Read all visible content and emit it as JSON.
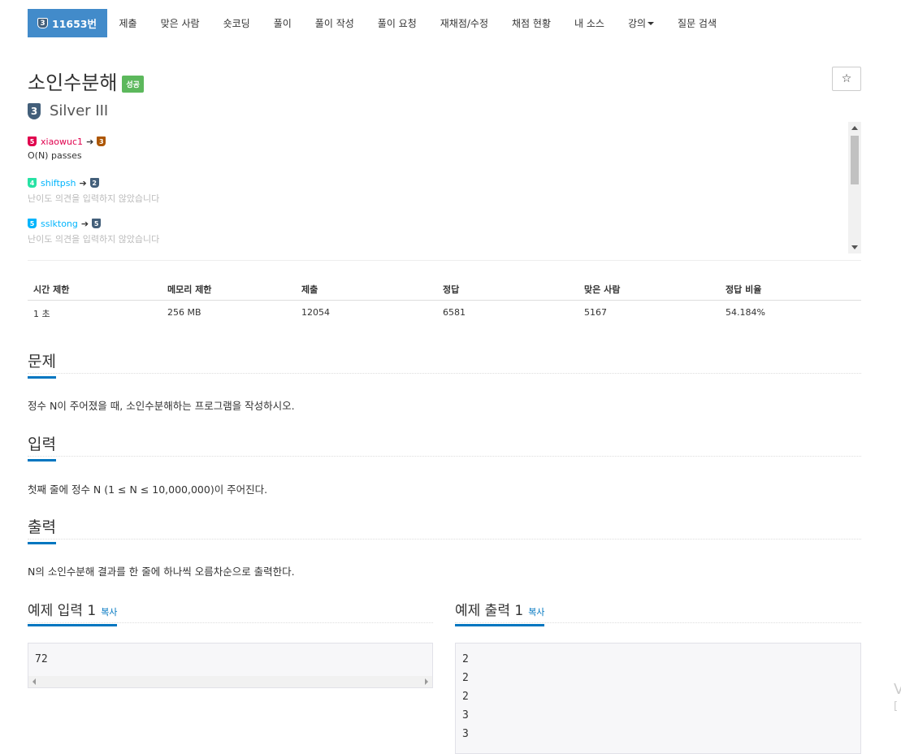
{
  "nav": {
    "active": {
      "tier": "3",
      "label": "11653번"
    },
    "items": [
      "제출",
      "맞은 사람",
      "숏코딩",
      "풀이",
      "풀이 작성",
      "풀이 요청",
      "재채점/수정",
      "채점 현황",
      "내 소스",
      "강의",
      "질문 검색"
    ]
  },
  "problem": {
    "title": "소인수분해",
    "status_badge": "성공",
    "star": "☆",
    "tier_number": "3",
    "tier_name": "Silver III"
  },
  "opinions": [
    {
      "from_tier": "5",
      "from_color": "#e0004d",
      "user": "xiaowuc1",
      "user_color": "#e0004d",
      "to_tier": "3",
      "to_color": "#ad5600",
      "text": "O(N) passes",
      "text_color": "#333333"
    },
    {
      "from_tier": "4",
      "from_color": "#27e2a4",
      "user": "shiftpsh",
      "user_color": "#00b4fc",
      "to_tier": "2",
      "to_color": "#435f7a",
      "text": "난이도 의견을 입력하지 않았습니다",
      "text_color": "#bbbbbb"
    },
    {
      "from_tier": "5",
      "from_color": "#00b4fc",
      "user": "sslktong",
      "user_color": "#00b4fc",
      "to_tier": "5",
      "to_color": "#435f7a",
      "text": "난이도 의견을 입력하지 않았습니다",
      "text_color": "#bbbbbb"
    }
  ],
  "stats": {
    "headers": [
      "시간 제한",
      "메모리 제한",
      "제출",
      "정답",
      "맞은 사람",
      "정답 비율"
    ],
    "values": [
      "1 초",
      "256 MB",
      "12054",
      "6581",
      "5167",
      "54.184%"
    ]
  },
  "sections": {
    "problem_head": "문제",
    "problem_text": "정수 N이 주어졌을 때, 소인수분해하는 프로그램을 작성하시오.",
    "input_head": "입력",
    "input_text": "첫째 줄에 정수 N (1 ≤ N ≤ 10,000,000)이 주어진다.",
    "output_head": "출력",
    "output_text": "N의 소인수분해 결과를 한 줄에 하나씩 오름차순으로 출력한다."
  },
  "samples": {
    "input_head": "예제 입력 1",
    "output_head": "예제 출력 1",
    "copy_label": "복사",
    "input_lines": [
      "72"
    ],
    "output_lines": [
      "2",
      "2",
      "2",
      "3",
      "3"
    ]
  },
  "edge_text": {
    "a": "V",
    "b": "["
  }
}
